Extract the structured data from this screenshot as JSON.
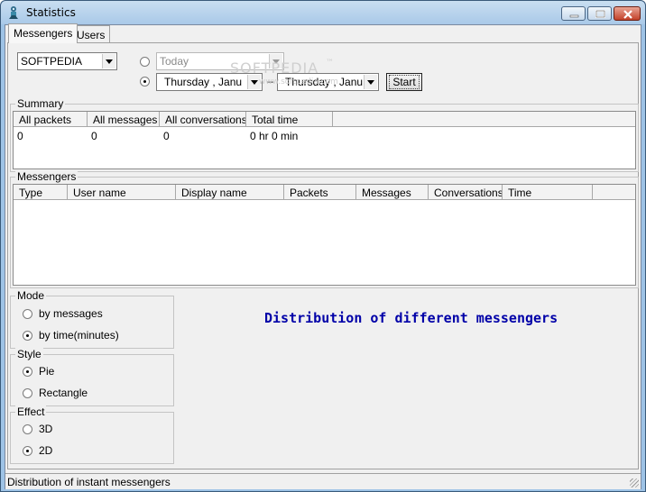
{
  "window": {
    "title": "Statistics",
    "app_icon": "rocket-person-icon"
  },
  "tabs": [
    {
      "label": "Messengers",
      "active": true
    },
    {
      "label": "Users",
      "active": false
    }
  ],
  "filters": {
    "messenger_select": "SOFTPEDIA",
    "today_select": "Today",
    "date_from": "Thursday  ,  Janu",
    "date_to": "Thursday  ,  Janu",
    "date_separator": "–",
    "start_button": "Start",
    "range_mode": "date-range"
  },
  "watermark": {
    "main": "SOFTPEDIA",
    "trademark": "™",
    "url": "www.softpedia.com"
  },
  "summary": {
    "title": "Summary",
    "columns": [
      "All packets",
      "All messages",
      "All conversations",
      "Total time"
    ],
    "rows": [
      [
        "0",
        "0",
        "0",
        "0 hr 0 min"
      ]
    ]
  },
  "messengers": {
    "title": "Messengers",
    "columns": [
      "Type",
      "User name",
      "Display name",
      "Packets",
      "Messages",
      "Conversations",
      "Time"
    ],
    "rows": []
  },
  "mode": {
    "title": "Mode",
    "options": [
      "by messages",
      "by time(minutes)"
    ],
    "selected": "by time(minutes)"
  },
  "style": {
    "title": "Style",
    "options": [
      "Pie",
      "Rectangle"
    ],
    "selected": "Pie"
  },
  "effect": {
    "title": "Effect",
    "options": [
      "3D",
      "2D"
    ],
    "selected": "2D"
  },
  "chart_title": "Distribution of different messengers",
  "status": {
    "text": "Distribution of instant messengers"
  },
  "colors": {
    "heading": "#0000a8",
    "titlebar": "#b9d3ec",
    "close_button": "#c2412a",
    "client_bg": "#f0f0f0"
  }
}
